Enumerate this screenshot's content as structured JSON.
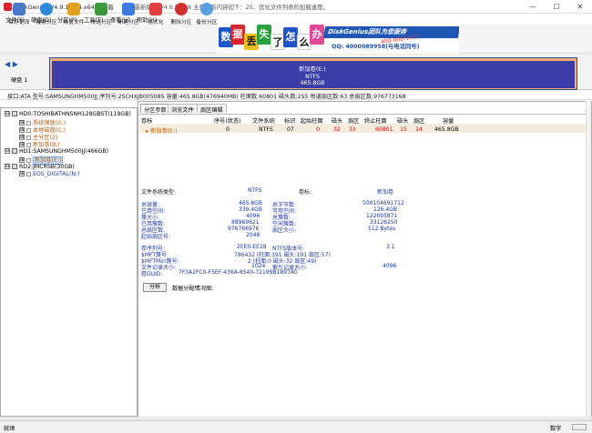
{
  "title": {
    "app": "DiskGenius V4.9.1.334 x64 专业版",
    "note": "当前最新版本 V4.9.5.508 主要更新内容如下：25、优化文件列表的加载速度。"
  },
  "window_controls": [
    "—",
    "☐",
    "✕"
  ],
  "menu": [
    "文件(F)",
    "硬盘(D)",
    "分区(P)",
    "工具(T)",
    "查看(V)",
    "帮助(H)"
  ],
  "toolbar": [
    {
      "label": "保存更改",
      "color": "#4a78c8"
    },
    {
      "label": "搜索分区",
      "color": "#2d8ad8"
    },
    {
      "label": "恢复文件",
      "color": "#e0a020"
    },
    {
      "label": "快速分区",
      "color": "#3a9a3a"
    },
    {
      "label": "新建分区",
      "color": "#3b7be0"
    },
    {
      "label": "格式化",
      "color": "#e04040"
    },
    {
      "label": "删除分区",
      "color": "#d03030"
    },
    {
      "label": "备份分区",
      "color": "#5aa0e0"
    }
  ],
  "banner": {
    "tiles": [
      {
        "ch": "数",
        "color": "#1d54c8"
      },
      {
        "ch": "据",
        "color": "#d8262e"
      },
      {
        "ch": "丢",
        "color": "#f0c020"
      },
      {
        "ch": "失",
        "color": "#2aa040"
      },
      {
        "ch": "了",
        "color": "#ffffff"
      },
      {
        "ch": "怎",
        "color": "#1d54c8"
      },
      {
        "ch": "么",
        "color": "#ffffff"
      },
      {
        "ch": "办",
        "color": "#e04898"
      }
    ],
    "brand": "DiskGenius团队为您服务",
    "tel": "400-008-9958",
    "qq": "QQ: 4000089958(与电话同号)"
  },
  "diskmap": {
    "nav": "◀ ▶",
    "disk_label": "硬盘 1",
    "partition_name": "新加卷(E:)",
    "partition_fs": "NTFS",
    "partition_size": "465.8GB"
  },
  "info_strip": "接口:ATA  型号:SAMSUNGHM500JJ  序列号:2SCHXJB005085  容量:465.8GB(476940MB)  柱面数:60801  磁头数:255  每道扇区数:63  总扇区数:976773168",
  "tree": [
    {
      "label": "HD0:TOSHIBATHNSNH128GBST(119GB)",
      "level": 0,
      "color": "black",
      "box": "⊟"
    },
    {
      "label": "系统保留(G:)",
      "level": 1,
      "color": "orange",
      "box": "⊞"
    },
    {
      "label": "本地磁盘(C:)",
      "level": 1,
      "color": "orange",
      "box": "⊞"
    },
    {
      "label": "主分区(2)",
      "level": 1,
      "color": "orange",
      "box": "⊞"
    },
    {
      "label": "新加卷(B:)",
      "level": 1,
      "color": "orange",
      "box": "⊞"
    },
    {
      "label": "HD1:SAMSUNGHM500JJ(466GB)",
      "level": 0,
      "color": "black",
      "box": "⊟"
    },
    {
      "label": "新加卷(E:)",
      "level": 1,
      "color": "orange",
      "box": "⊞",
      "selected": true
    },
    {
      "label": "RD2:JMCRSB(30GB)",
      "level": 0,
      "color": "black",
      "box": "⊟"
    },
    {
      "label": "EOS_DIGITAL(N:)",
      "level": 1,
      "color": "blue",
      "box": "⊞"
    }
  ],
  "tabs": [
    "分区参数",
    "浏览文件",
    "扇区编辑"
  ],
  "table": {
    "headers": [
      "卷标",
      "序号(状态)",
      "文件系统",
      "标识",
      "起始柱面",
      "磁头",
      "扇区",
      "终止柱面",
      "磁头",
      "扇区",
      "容量"
    ],
    "row": [
      "新加卷(E:)",
      "0",
      "NTFS",
      "07",
      "0",
      "32",
      "33",
      "60801",
      "15",
      "14",
      "465.8GB"
    ]
  },
  "details": {
    "fs_type_label": "文件系统类型:",
    "fs_type": "NTFS",
    "vol_label_label": "卷标:",
    "vol_label": "新加卷",
    "rows_left": [
      [
        "总容量:",
        "465.8GB"
      ],
      [
        "已用空间:",
        "339.4GB"
      ],
      [
        "簇大小:",
        "4096"
      ],
      [
        "已用簇数:",
        "88969621"
      ],
      [
        "总扇区数:",
        "976766976"
      ],
      [
        "起始扇区号:",
        "2048"
      ]
    ],
    "rows_right": [
      [
        "总字节数:",
        "500104691712"
      ],
      [
        "可用空间:",
        "126.4GB"
      ],
      [
        "总簇数:",
        "122095871"
      ],
      [
        "空闲簇数:",
        "33126250"
      ],
      [
        "扇区大小:",
        "512 Bytes"
      ]
    ],
    "serial_label": "卷序列号:",
    "serial": "2EE0-EE28",
    "ntfs_ver_label": "NTFS版本号:",
    "ntfs_ver": "3.1",
    "mft_label": "$MFT簇号:",
    "mft": "786432 (柱面:391 磁头:191 扇区:57)",
    "mftmirr_label": "$MFTMirr簇号:",
    "mftmirr": "2 (柱面:0 磁头:32 扇区:49)",
    "rec_label": "文件记录大小:",
    "rec": "1024",
    "idx_label": "索引记录大小:",
    "idx": "4096",
    "guid_label": "卷GUID:",
    "guid": "7F3A2FC0-F5EF-436A-8540-72199B1897A0"
  },
  "analyze_button": "分析",
  "analyze_label": "数据分配情况图:",
  "status": {
    "left": "就绪",
    "right": "数字"
  }
}
